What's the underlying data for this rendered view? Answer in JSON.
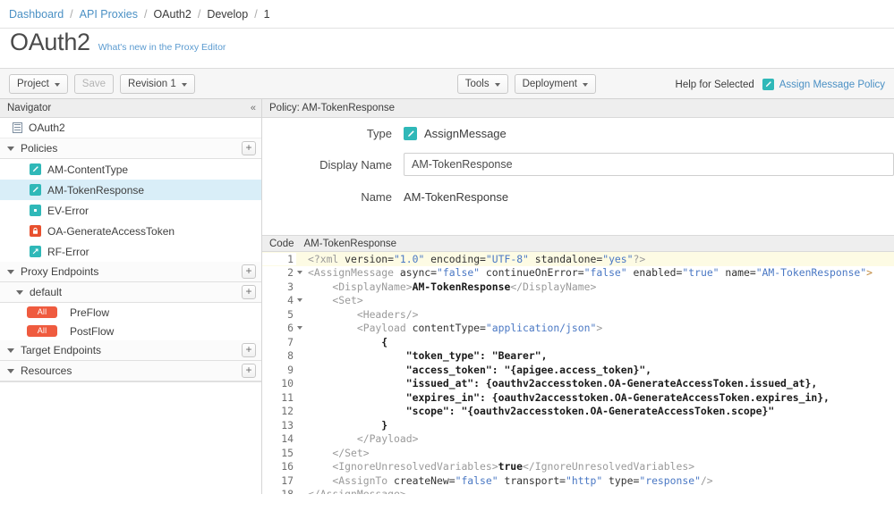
{
  "breadcrumb": {
    "items": [
      {
        "label": "Dashboard",
        "link": true
      },
      {
        "label": "API Proxies",
        "link": true
      },
      {
        "label": "OAuth2",
        "link": false
      },
      {
        "label": "Develop",
        "link": false
      },
      {
        "label": "1",
        "link": false
      }
    ],
    "separator": "/"
  },
  "header": {
    "title": "OAuth2",
    "whats_new": "What's new in the Proxy Editor"
  },
  "toolbar": {
    "project_label": "Project",
    "save_label": "Save",
    "revision_label": "Revision 1",
    "tools_label": "Tools",
    "deployment_label": "Deployment",
    "help_for_selected": "Help for Selected",
    "assign_message_policy": "Assign Message Policy",
    "assign_icon": "assign-message-icon"
  },
  "navigator": {
    "title": "Navigator",
    "collapse_icon": "«",
    "root": {
      "label": "OAuth2",
      "icon": "proxy-bundle-icon"
    },
    "sections": [
      {
        "label": "Policies",
        "add_label": "+",
        "items": [
          {
            "label": "AM-ContentType",
            "icon": "assign-message-icon",
            "color": "#2fb8b8",
            "selected": false
          },
          {
            "label": "AM-TokenResponse",
            "icon": "assign-message-icon",
            "color": "#2fb8b8",
            "selected": true
          },
          {
            "label": "EV-Error",
            "icon": "extract-variables-icon",
            "color": "#2fb8b8",
            "selected": false
          },
          {
            "label": "OA-GenerateAccessToken",
            "icon": "oauth-lock-icon",
            "color": "#e8502e",
            "selected": false
          },
          {
            "label": "RF-Error",
            "icon": "raise-fault-icon",
            "color": "#2fb8b8",
            "selected": false
          }
        ]
      },
      {
        "label": "Proxy Endpoints",
        "add_label": "+",
        "items": []
      },
      {
        "label": "default",
        "add_label": "+",
        "sub": true,
        "flows": [
          {
            "badge": "All",
            "label": "PreFlow"
          },
          {
            "badge": "All",
            "label": "PostFlow"
          }
        ]
      },
      {
        "label": "Target Endpoints",
        "add_label": "+",
        "items": []
      },
      {
        "label": "Resources",
        "add_label": "+",
        "items": []
      }
    ]
  },
  "detail": {
    "pane_title": "Policy: AM-TokenResponse",
    "type_label": "Type",
    "type_value": "AssignMessage",
    "type_icon": "assign-message-icon",
    "display_name_label": "Display Name",
    "display_name_value": "AM-TokenResponse",
    "display_name_placeholder": "Display Name",
    "name_label": "Name",
    "name_value": "AM-TokenResponse"
  },
  "code": {
    "tab_label": "Code",
    "file_name": "AM-TokenResponse",
    "active_line": 1,
    "lines": [
      {
        "n": 1,
        "fold": false,
        "active": true,
        "parts": [
          {
            "t": "<?xml ",
            "c": "tok-tag"
          },
          {
            "t": "version=",
            "c": "tok-attr"
          },
          {
            "t": "\"1.0\"",
            "c": "tok-val"
          },
          {
            "t": " encoding=",
            "c": "tok-attr"
          },
          {
            "t": "\"UTF-8\"",
            "c": "tok-val"
          },
          {
            "t": " standalone=",
            "c": "tok-attr"
          },
          {
            "t": "\"yes\"",
            "c": "tok-val"
          },
          {
            "t": "?>",
            "c": "tok-tag"
          }
        ]
      },
      {
        "n": 2,
        "fold": true,
        "active": false,
        "parts": [
          {
            "t": "<AssignMessage ",
            "c": "tok-tag"
          },
          {
            "t": "async=",
            "c": "tok-attr"
          },
          {
            "t": "\"false\"",
            "c": "tok-val"
          },
          {
            "t": " continueOnError=",
            "c": "tok-attr"
          },
          {
            "t": "\"false\"",
            "c": "tok-val"
          },
          {
            "t": " enabled=",
            "c": "tok-attr"
          },
          {
            "t": "\"true\"",
            "c": "tok-val"
          },
          {
            "t": " name=",
            "c": "tok-attr"
          },
          {
            "t": "\"AM-TokenResponse\"",
            "c": "tok-val"
          },
          {
            "t": ">",
            "c": "tok-punc"
          }
        ]
      },
      {
        "n": 3,
        "fold": false,
        "active": false,
        "parts": [
          {
            "t": "    <DisplayName>",
            "c": "tok-tag"
          },
          {
            "t": "AM-TokenResponse",
            "c": "tok-txt"
          },
          {
            "t": "</DisplayName>",
            "c": "tok-tag"
          }
        ]
      },
      {
        "n": 4,
        "fold": true,
        "active": false,
        "parts": [
          {
            "t": "    <Set>",
            "c": "tok-tag"
          }
        ]
      },
      {
        "n": 5,
        "fold": false,
        "active": false,
        "parts": [
          {
            "t": "        <Headers/>",
            "c": "tok-tag"
          }
        ]
      },
      {
        "n": 6,
        "fold": true,
        "active": false,
        "parts": [
          {
            "t": "        <Payload ",
            "c": "tok-tag"
          },
          {
            "t": "contentType=",
            "c": "tok-attr"
          },
          {
            "t": "\"application/json\"",
            "c": "tok-val"
          },
          {
            "t": ">",
            "c": "tok-tag"
          }
        ]
      },
      {
        "n": 7,
        "fold": false,
        "active": false,
        "parts": [
          {
            "t": "            {",
            "c": "tok-txt"
          }
        ]
      },
      {
        "n": 8,
        "fold": false,
        "active": false,
        "parts": [
          {
            "t": "                \"token_type\": \"Bearer\",",
            "c": "tok-txt"
          }
        ]
      },
      {
        "n": 9,
        "fold": false,
        "active": false,
        "parts": [
          {
            "t": "                \"access_token\": \"{apigee.access_token}\",",
            "c": "tok-txt"
          }
        ]
      },
      {
        "n": 10,
        "fold": false,
        "active": false,
        "parts": [
          {
            "t": "                \"issued_at\": {oauthv2accesstoken.OA-GenerateAccessToken.issued_at},",
            "c": "tok-txt"
          }
        ]
      },
      {
        "n": 11,
        "fold": false,
        "active": false,
        "parts": [
          {
            "t": "                \"expires_in\": {oauthv2accesstoken.OA-GenerateAccessToken.expires_in},",
            "c": "tok-txt"
          }
        ]
      },
      {
        "n": 12,
        "fold": false,
        "active": false,
        "parts": [
          {
            "t": "                \"scope\": \"{oauthv2accesstoken.OA-GenerateAccessToken.scope}\"",
            "c": "tok-txt"
          }
        ]
      },
      {
        "n": 13,
        "fold": false,
        "active": false,
        "parts": [
          {
            "t": "            }",
            "c": "tok-txt"
          }
        ]
      },
      {
        "n": 14,
        "fold": false,
        "active": false,
        "parts": [
          {
            "t": "        </Payload>",
            "c": "tok-tag"
          }
        ]
      },
      {
        "n": 15,
        "fold": false,
        "active": false,
        "parts": [
          {
            "t": "    </Set>",
            "c": "tok-tag"
          }
        ]
      },
      {
        "n": 16,
        "fold": false,
        "active": false,
        "parts": [
          {
            "t": "    <IgnoreUnresolvedVariables>",
            "c": "tok-tag"
          },
          {
            "t": "true",
            "c": "tok-txt"
          },
          {
            "t": "</IgnoreUnresolvedVariables>",
            "c": "tok-tag"
          }
        ]
      },
      {
        "n": 17,
        "fold": false,
        "active": false,
        "parts": [
          {
            "t": "    <AssignTo ",
            "c": "tok-tag"
          },
          {
            "t": "createNew=",
            "c": "tok-attr"
          },
          {
            "t": "\"false\"",
            "c": "tok-val"
          },
          {
            "t": " transport=",
            "c": "tok-attr"
          },
          {
            "t": "\"http\"",
            "c": "tok-val"
          },
          {
            "t": " type=",
            "c": "tok-attr"
          },
          {
            "t": "\"response\"",
            "c": "tok-val"
          },
          {
            "t": "/>",
            "c": "tok-tag"
          }
        ]
      },
      {
        "n": 18,
        "fold": false,
        "active": false,
        "parts": [
          {
            "t": "</AssignMessage>",
            "c": "tok-tag"
          }
        ]
      }
    ]
  }
}
